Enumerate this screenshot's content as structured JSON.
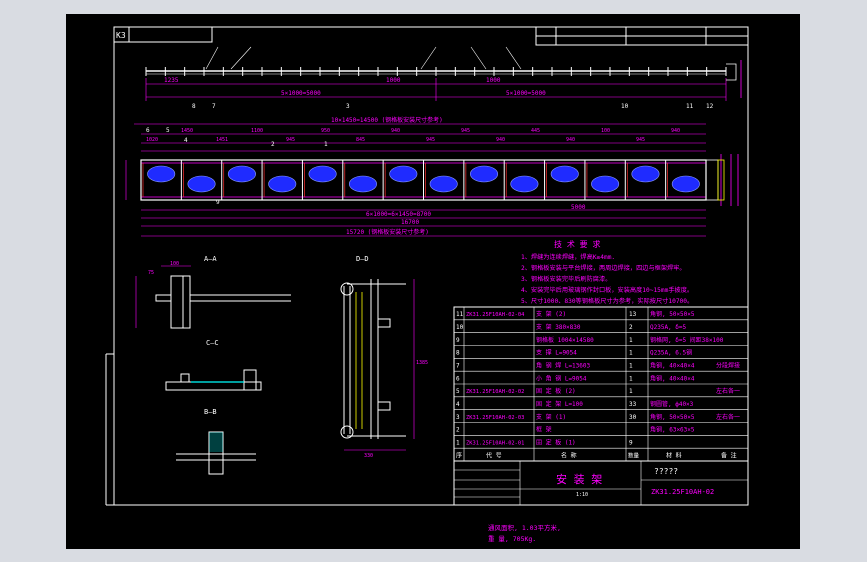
{
  "sheet": {
    "drawing_code": "K3",
    "scale_mark": "1:10"
  },
  "top_dims": {
    "left_pitch": "5×1000=5000",
    "right_pitch": "5×1000=5000",
    "d1": "1235",
    "d2": "1000",
    "d3": "1000"
  },
  "main_view": {
    "pitch_label": "10×1450=14500 (钢格板安装尺寸参考)",
    "bottom_pitch": "6×1000=6×1450=8700",
    "overall": "15720",
    "overall_label": "15720 (钢格板安装尺寸参考)",
    "sub_dim": "16700",
    "mid_dim": "5000",
    "small_dims": [
      "1020",
      "1450",
      "1451",
      "1100",
      "945",
      "950",
      "845",
      "940",
      "945",
      "945",
      "940",
      "445",
      "940",
      "100",
      "945",
      "940"
    ],
    "section_marks": [
      "A",
      "B",
      "C",
      "D",
      "A",
      "B",
      "D"
    ],
    "callouts": [
      "8",
      "7",
      "6",
      "5",
      "4",
      "3",
      "2",
      "1",
      "10",
      "11",
      "12",
      "9"
    ]
  },
  "sections": {
    "aa": {
      "label": "A—A",
      "dims": [
        "100",
        "75",
        "80",
        "180"
      ]
    },
    "cc": {
      "label": "C—C"
    },
    "bb": {
      "label": "B—B"
    },
    "dd": {
      "label": "D—D",
      "dims": [
        "180",
        "180",
        "1385",
        "330",
        "160"
      ]
    }
  },
  "tech_notes": {
    "title": "技 术 要 求",
    "lines": [
      "1、焊缝为连续焊缝，焊高K≥4mm.",
      "2、钢格板安装与平台焊接，两周边焊接，四边与框架焊牢。",
      "3、钢格板安装完毕后刷防腐漆。",
      "4、安装完毕后用玻璃钢作封口板，安装高度10~15mm手披度。",
      "5、尺寸1000、830等钢格板尺寸为参考，实际按尺寸10700。"
    ]
  },
  "bom": {
    "header": {
      "no": "序",
      "code": "代  号",
      "name": "名   称",
      "qty": "数量",
      "material": "材   料",
      "remark": "备 注"
    },
    "rows": [
      {
        "no": "11",
        "code": "ZK31.25F10AH-02-04",
        "name": "支  架 (2)",
        "qty": "13",
        "material": "角钢, 50×50×5",
        "remark": ""
      },
      {
        "no": "10",
        "code": "",
        "name": "支  架  380×830",
        "qty": "2",
        "material": "Q235A, δ=5",
        "remark": ""
      },
      {
        "no": "9",
        "code": "",
        "name": "钢格板 1004×14580",
        "qty": "1",
        "material": "钢格网, δ=5  间距38×100",
        "remark": ""
      },
      {
        "no": "8",
        "code": "",
        "name": "支  撑    L=9054",
        "qty": "1",
        "material": "Q235A, 6.5钢",
        "remark": ""
      },
      {
        "no": "7",
        "code": "",
        "name": "角 钢 焊   L=13603",
        "qty": "1",
        "material": "角钢, 40×40×4",
        "remark": "分段焊接"
      },
      {
        "no": "6",
        "code": "",
        "name": "小 角 钢   L=9054",
        "qty": "1",
        "material": "角钢, 40×40×4",
        "remark": ""
      },
      {
        "no": "5",
        "code": "ZK31.25F10AH-02-02",
        "name": "固 定 板 (2)",
        "qty": "1",
        "material": "",
        "remark": "左右各一"
      },
      {
        "no": "4",
        "code": "",
        "name": "固 定 架    L=100",
        "qty": "33",
        "material": "钢圆管, ф40×3",
        "remark": ""
      },
      {
        "no": "3",
        "code": "ZK31.25F10AH-02-03",
        "name": "支  架 (1)",
        "qty": "30",
        "material": "角钢, 50×50×5",
        "remark": "左右各一"
      },
      {
        "no": "2",
        "code": "",
        "name": "框  架",
        "qty": "",
        "material": "角钢, 63×63×5",
        "remark": ""
      },
      {
        "no": "1",
        "code": "ZK31.25F10AH-02-01",
        "name": "固 定 板 (1)",
        "qty": "9",
        "material": "",
        "remark": ""
      }
    ]
  },
  "title_block": {
    "title": "安 装 架",
    "drawing_no": "ZK31.25F10AH-02",
    "placeholder": "?????"
  },
  "footnote": {
    "line1": "通风面积, 1.03平方米,",
    "line2": "重  量, 705Kg."
  },
  "colors": {
    "background": "#000000",
    "frame": "#ffffff",
    "dimension": "#ff00ff",
    "filter_fill": "#1f2bff",
    "note_text": "#ff00ff",
    "bom_text": "#ff00ff",
    "detail_line": "#ffff00",
    "accent": "#ff3030"
  }
}
